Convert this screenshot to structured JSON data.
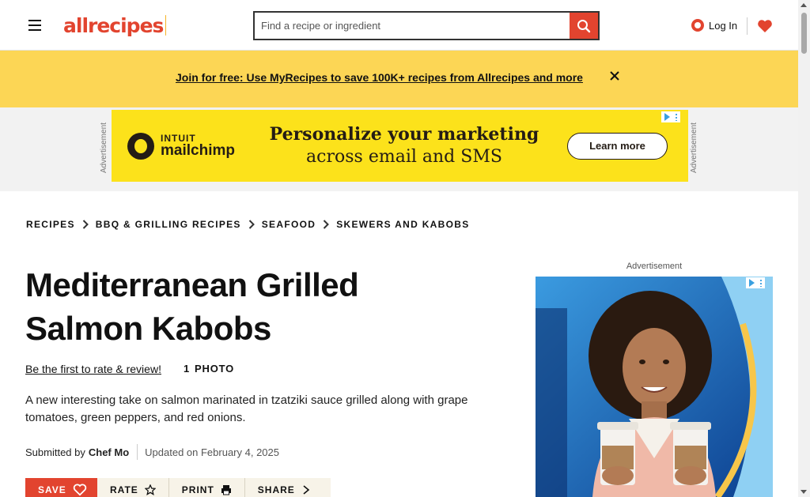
{
  "header": {
    "logo_text": "allrecipes",
    "search_placeholder": "Find a recipe or ingredient",
    "login_label": "Log In"
  },
  "promo": {
    "link_text": "Join for free: Use MyRecipes to save 100K+ recipes from Allrecipes and more"
  },
  "ad_banner": {
    "side_label": "Advertisement",
    "brand_top": "INTUIT",
    "brand_bottom": "mailchimp",
    "headline_line1": "Personalize your marketing",
    "headline_line2": "across email and SMS",
    "cta": "Learn more"
  },
  "breadcrumb": [
    "RECIPES",
    "BBQ & GRILLING RECIPES",
    "SEAFOOD",
    "SKEWERS AND KABOBS"
  ],
  "recipe": {
    "title": "Mediterranean Grilled Salmon Kabobs",
    "rate_link": "Be the first to rate & review!",
    "photo_count": "1",
    "photo_label": "PHOTO",
    "description": "A new interesting take on salmon marinated in tzatziki sauce grilled along with grape tomatoes, green peppers, and red onions.",
    "submitted_prefix": "Submitted by",
    "author": "Chef Mo",
    "updated": "Updated on February 4, 2025"
  },
  "actions": {
    "save": "SAVE",
    "rate": "RATE",
    "print": "PRINT",
    "share": "SHARE"
  },
  "right_ad": {
    "caption": "Advertisement"
  },
  "colors": {
    "brand": "#e2442f",
    "promo_bg": "#fcd655",
    "ad_yellow": "#fce21b"
  }
}
